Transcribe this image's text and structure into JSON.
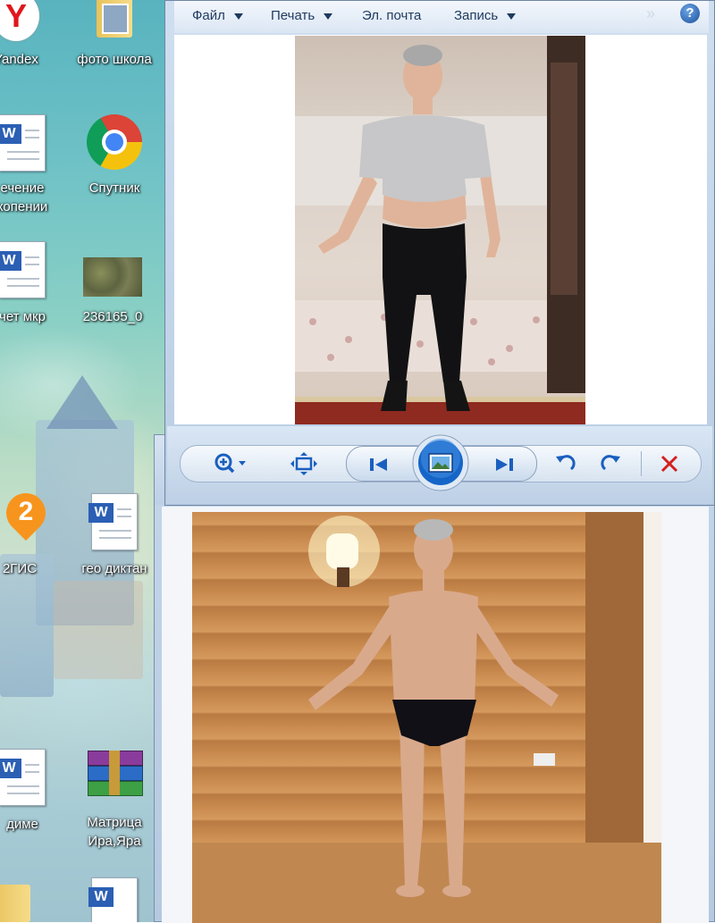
{
  "desktop": {
    "icons": [
      {
        "label": "Yandex",
        "type": "yandex"
      },
      {
        "label": "фото школа",
        "type": "folder"
      },
      {
        "label": "ечение\nкопении",
        "type": "word"
      },
      {
        "label": "Спутник",
        "type": "chrome"
      },
      {
        "label": "чет мкр",
        "type": "word"
      },
      {
        "label": "236165_0",
        "type": "image"
      },
      {
        "label": "2ГИС",
        "type": "2gis"
      },
      {
        "label": "гео диктан",
        "type": "word"
      },
      {
        "label": "диме",
        "type": "word"
      },
      {
        "label": "Матрица\nИра,Яра",
        "type": "winrar"
      }
    ],
    "badge_2gis": "2"
  },
  "viewer": {
    "menu": {
      "file": "Файл",
      "print": "Печать",
      "email": "Эл. почта",
      "burn": "Запись"
    },
    "overflow": "»",
    "help": "?",
    "toolbar": {
      "zoom": "zoom-icon",
      "fit": "fit-window-icon",
      "prev": "previous-icon",
      "slideshow": "slideshow-icon",
      "next": "next-icon",
      "rotate_left": "rotate-ccw-icon",
      "rotate_right": "rotate-cw-icon",
      "delete": "delete-icon"
    },
    "colors": {
      "accent": "#1a5fc0",
      "delete": "#d42020"
    }
  }
}
